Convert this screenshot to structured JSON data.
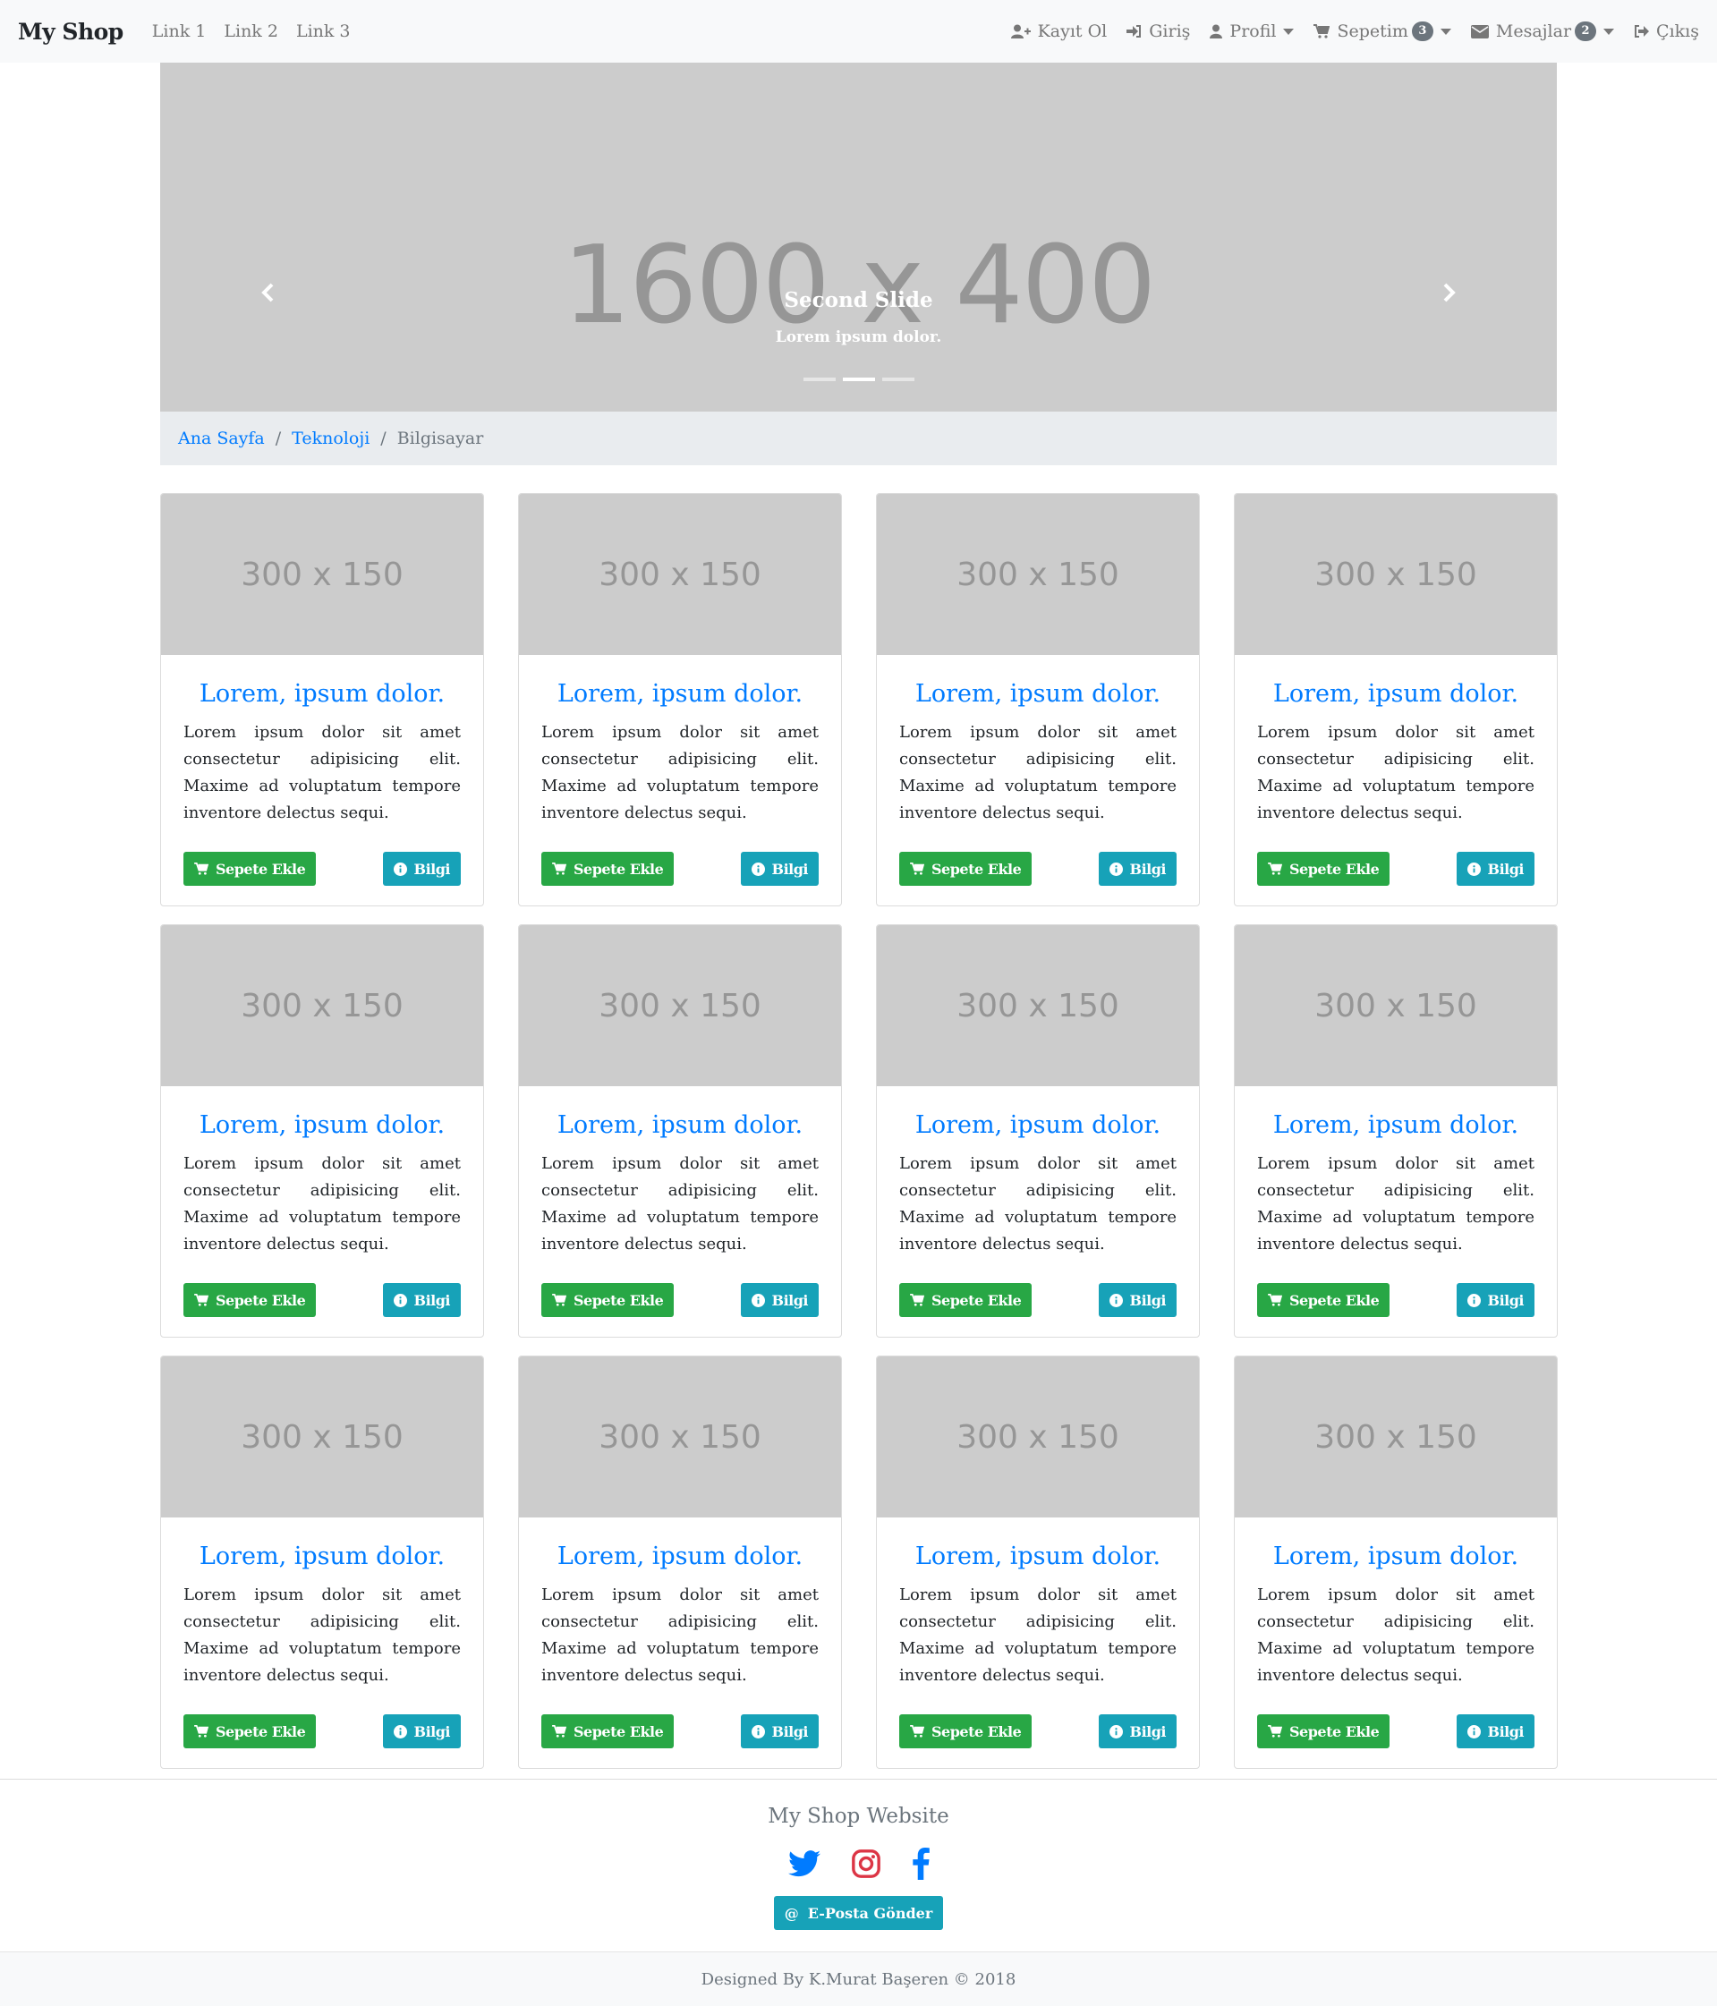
{
  "navbar": {
    "brand": "My Shop",
    "links": [
      "Link 1",
      "Link 2",
      "Link 3"
    ],
    "register": "Kayıt Ol",
    "login": "Giriş",
    "profile": "Profil",
    "cart": "Sepetim",
    "cart_count": "3",
    "messages": "Mesajlar",
    "messages_count": "2",
    "logout": "Çıkış"
  },
  "carousel": {
    "placeholder": "1600 x 400",
    "caption_title": "Second Slide",
    "caption_text": "Lorem ipsum dolor.",
    "slide_count": 3,
    "active_slide": 2
  },
  "breadcrumb": {
    "items": [
      "Ana Sayfa",
      "Teknoloji"
    ],
    "active": "Bilgisayar"
  },
  "products": [
    {
      "image": "300 x 150",
      "title": "Lorem, ipsum dolor.",
      "text": "Lorem ipsum dolor sit amet consectetur adipisicing elit. Maxime ad voluptatum tempore inventore delectus sequi.",
      "add_label": "Sepete Ekle",
      "info_label": "Bilgi"
    },
    {
      "image": "300 x 150",
      "title": "Lorem, ipsum dolor.",
      "text": "Lorem ipsum dolor sit amet consectetur adipisicing elit. Maxime ad voluptatum tempore inventore delectus sequi.",
      "add_label": "Sepete Ekle",
      "info_label": "Bilgi"
    },
    {
      "image": "300 x 150",
      "title": "Lorem, ipsum dolor.",
      "text": "Lorem ipsum dolor sit amet consectetur adipisicing elit. Maxime ad voluptatum tempore inventore delectus sequi.",
      "add_label": "Sepete Ekle",
      "info_label": "Bilgi"
    },
    {
      "image": "300 x 150",
      "title": "Lorem, ipsum dolor.",
      "text": "Lorem ipsum dolor sit amet consectetur adipisicing elit. Maxime ad voluptatum tempore inventore delectus sequi.",
      "add_label": "Sepete Ekle",
      "info_label": "Bilgi"
    },
    {
      "image": "300 x 150",
      "title": "Lorem, ipsum dolor.",
      "text": "Lorem ipsum dolor sit amet consectetur adipisicing elit. Maxime ad voluptatum tempore inventore delectus sequi.",
      "add_label": "Sepete Ekle",
      "info_label": "Bilgi"
    },
    {
      "image": "300 x 150",
      "title": "Lorem, ipsum dolor.",
      "text": "Lorem ipsum dolor sit amet consectetur adipisicing elit. Maxime ad voluptatum tempore inventore delectus sequi.",
      "add_label": "Sepete Ekle",
      "info_label": "Bilgi"
    },
    {
      "image": "300 x 150",
      "title": "Lorem, ipsum dolor.",
      "text": "Lorem ipsum dolor sit amet consectetur adipisicing elit. Maxime ad voluptatum tempore inventore delectus sequi.",
      "add_label": "Sepete Ekle",
      "info_label": "Bilgi"
    },
    {
      "image": "300 x 150",
      "title": "Lorem, ipsum dolor.",
      "text": "Lorem ipsum dolor sit amet consectetur adipisicing elit. Maxime ad voluptatum tempore inventore delectus sequi.",
      "add_label": "Sepete Ekle",
      "info_label": "Bilgi"
    },
    {
      "image": "300 x 150",
      "title": "Lorem, ipsum dolor.",
      "text": "Lorem ipsum dolor sit amet consectetur adipisicing elit. Maxime ad voluptatum tempore inventore delectus sequi.",
      "add_label": "Sepete Ekle",
      "info_label": "Bilgi"
    },
    {
      "image": "300 x 150",
      "title": "Lorem, ipsum dolor.",
      "text": "Lorem ipsum dolor sit amet consectetur adipisicing elit. Maxime ad voluptatum tempore inventore delectus sequi.",
      "add_label": "Sepete Ekle",
      "info_label": "Bilgi"
    },
    {
      "image": "300 x 150",
      "title": "Lorem, ipsum dolor.",
      "text": "Lorem ipsum dolor sit amet consectetur adipisicing elit. Maxime ad voluptatum tempore inventore delectus sequi.",
      "add_label": "Sepete Ekle",
      "info_label": "Bilgi"
    },
    {
      "image": "300 x 150",
      "title": "Lorem, ipsum dolor.",
      "text": "Lorem ipsum dolor sit amet consectetur adipisicing elit. Maxime ad voluptatum tempore inventore delectus sequi.",
      "add_label": "Sepete Ekle",
      "info_label": "Bilgi"
    }
  ],
  "footer": {
    "title": "My Shop Website",
    "social": [
      "twitter-icon",
      "instagram-icon",
      "facebook-icon"
    ],
    "email_button": "E-Posta Gönder",
    "copyright": "Designed By K.Murat Başeren © 2018"
  },
  "colors": {
    "primary": "#007bff",
    "success": "#28a745",
    "info": "#17a2b8",
    "instagram": "#e4405f",
    "twitter": "#1da1f2"
  }
}
